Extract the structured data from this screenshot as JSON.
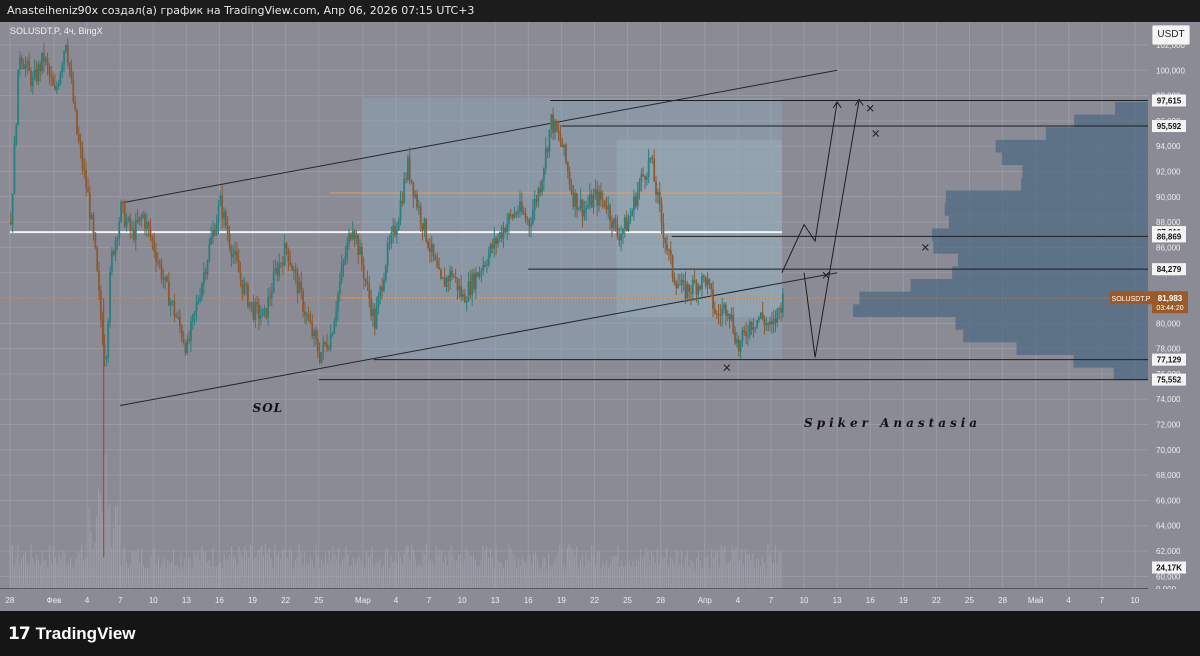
{
  "header": {
    "caption": "Anasteiheniz90x создал(а) график на TradingView.com, Апр 06, 2026 07:15 UTC+3"
  },
  "footer": {
    "logo_mark": "17",
    "logo_text": "TradingView"
  },
  "currency_button": "USDT",
  "colors": {
    "background": "#8b8b96",
    "up_candle": "#2a7f7f",
    "down_candle": "#8b5a32",
    "volume_profile": "#4f6a82",
    "value_area": "#8fa7b8",
    "level_line": "#1e1e1e",
    "orange_line": "#e0a060",
    "white_line": "#f2f2f2",
    "price_label_bg": "#9a5a2a"
  },
  "chart_data": {
    "type": "candlestick",
    "symbol_label": "SOLUSDT.P, 4ч, BingX",
    "ylim": [
      59000,
      103500
    ],
    "y_ticks": [
      "102,000",
      "100,000",
      "98,000",
      "96,000",
      "94,000",
      "92,000",
      "90,000",
      "88,000",
      "86,000",
      "84,000",
      "82,000",
      "80,000",
      "78,000",
      "76,000",
      "74,000",
      "72,000",
      "70,000",
      "68,000",
      "66,000",
      "64,000",
      "62,000",
      "60,000",
      "0,000"
    ],
    "y_tick_values": [
      102000,
      100000,
      98000,
      96000,
      94000,
      92000,
      90000,
      88000,
      86000,
      84000,
      82000,
      80000,
      78000,
      76000,
      74000,
      72000,
      70000,
      68000,
      66000,
      64000,
      62000,
      60000,
      59000
    ],
    "x_ticks": [
      {
        "label": "28",
        "day": -4
      },
      {
        "label": "Фев",
        "day": 0
      },
      {
        "label": "4",
        "day": 3
      },
      {
        "label": "7",
        "day": 6
      },
      {
        "label": "10",
        "day": 9
      },
      {
        "label": "13",
        "day": 12
      },
      {
        "label": "16",
        "day": 15
      },
      {
        "label": "19",
        "day": 18
      },
      {
        "label": "22",
        "day": 21
      },
      {
        "label": "25",
        "day": 24
      },
      {
        "label": "Мар",
        "day": 28
      },
      {
        "label": "4",
        "day": 31
      },
      {
        "label": "7",
        "day": 34
      },
      {
        "label": "10",
        "day": 37
      },
      {
        "label": "13",
        "day": 40
      },
      {
        "label": "16",
        "day": 43
      },
      {
        "label": "19",
        "day": 46
      },
      {
        "label": "22",
        "day": 49
      },
      {
        "label": "25",
        "day": 52
      },
      {
        "label": "28",
        "day": 55
      },
      {
        "label": "Апр",
        "day": 59
      },
      {
        "label": "4",
        "day": 62
      },
      {
        "label": "7",
        "day": 65
      },
      {
        "label": "10",
        "day": 68
      },
      {
        "label": "13",
        "day": 71
      },
      {
        "label": "16",
        "day": 74
      },
      {
        "label": "19",
        "day": 77
      },
      {
        "label": "22",
        "day": 80
      },
      {
        "label": "25",
        "day": 83
      },
      {
        "label": "28",
        "day": 86
      },
      {
        "label": "Май",
        "day": 89
      },
      {
        "label": "4",
        "day": 92
      },
      {
        "label": "7",
        "day": 95
      },
      {
        "label": "10",
        "day": 98
      }
    ],
    "price_path": [
      [
        -4,
        88000
      ],
      [
        -3.2,
        101500
      ],
      [
        -2,
        99000
      ],
      [
        -1,
        101000
      ],
      [
        0,
        98000
      ],
      [
        1,
        102500
      ],
      [
        2,
        95000
      ],
      [
        3,
        90000
      ],
      [
        3.6,
        86000
      ],
      [
        4.2,
        80000
      ],
      [
        4.6,
        77000
      ],
      [
        5.1,
        85000
      ],
      [
        6,
        89000
      ],
      [
        7,
        87000
      ],
      [
        8,
        88500
      ],
      [
        9,
        86000
      ],
      [
        10,
        83000
      ],
      [
        11,
        80500
      ],
      [
        12,
        78000
      ],
      [
        13,
        82000
      ],
      [
        14,
        86000
      ],
      [
        15,
        89500
      ],
      [
        16,
        86000
      ],
      [
        17,
        83000
      ],
      [
        18,
        81000
      ],
      [
        19,
        80500
      ],
      [
        20,
        84000
      ],
      [
        21,
        86000
      ],
      [
        22,
        83000
      ],
      [
        23,
        80000
      ],
      [
        24,
        77500
      ],
      [
        25,
        79000
      ],
      [
        26,
        84000
      ],
      [
        27,
        88000
      ],
      [
        28,
        84000
      ],
      [
        29,
        80000
      ],
      [
        30,
        85000
      ],
      [
        31,
        88000
      ],
      [
        32,
        92500
      ],
      [
        33,
        89000
      ],
      [
        34,
        86000
      ],
      [
        35,
        83000
      ],
      [
        36,
        84000
      ],
      [
        37,
        82000
      ],
      [
        38,
        83500
      ],
      [
        39,
        85000
      ],
      [
        40,
        86500
      ],
      [
        41,
        88000
      ],
      [
        42,
        89000
      ],
      [
        43,
        88000
      ],
      [
        44,
        91000
      ],
      [
        45,
        96000
      ],
      [
        46,
        94000
      ],
      [
        47,
        90000
      ],
      [
        48,
        89000
      ],
      [
        49,
        90000
      ],
      [
        50,
        89500
      ],
      [
        51,
        87000
      ],
      [
        52,
        88000
      ],
      [
        53,
        91000
      ],
      [
        54,
        93000
      ],
      [
        55,
        88000
      ],
      [
        56,
        84000
      ],
      [
        57,
        82500
      ],
      [
        58,
        83000
      ],
      [
        59,
        83500
      ],
      [
        60,
        80500
      ],
      [
        61,
        81500
      ],
      [
        62,
        78000
      ],
      [
        63,
        80000
      ],
      [
        64,
        80500
      ],
      [
        65,
        79500
      ],
      [
        66,
        81983
      ]
    ],
    "volume_profile_bins": [
      [
        97000,
        0.1
      ],
      [
        96000,
        0.22
      ],
      [
        95000,
        0.35
      ],
      [
        94000,
        0.5
      ],
      [
        93000,
        0.45
      ],
      [
        92000,
        0.38
      ],
      [
        91000,
        0.44
      ],
      [
        90000,
        0.55
      ],
      [
        89000,
        0.6
      ],
      [
        88000,
        0.62
      ],
      [
        87000,
        0.7
      ],
      [
        86000,
        0.6
      ],
      [
        85000,
        0.55
      ],
      [
        84000,
        0.68
      ],
      [
        83000,
        0.72
      ],
      [
        82000,
        0.95
      ],
      [
        81000,
        0.85
      ],
      [
        80000,
        0.65
      ],
      [
        79000,
        0.55
      ],
      [
        78000,
        0.4
      ],
      [
        77000,
        0.25
      ],
      [
        76000,
        0.12
      ]
    ],
    "price_labels": [
      {
        "value": 97615,
        "text": "97,615"
      },
      {
        "value": 95592,
        "text": "95,592"
      },
      {
        "value": 87211,
        "text": "87,211"
      },
      {
        "value": 86869,
        "text": "86,869"
      },
      {
        "value": 84279,
        "text": "84,279"
      },
      {
        "value": 77129,
        "text": "77,129"
      },
      {
        "value": 75552,
        "text": "75,552"
      },
      {
        "value": 60700,
        "text": "24,17K"
      }
    ],
    "current_price": {
      "ticker": "SOLUSDT.P",
      "value": 81983,
      "text": "81,983",
      "countdown": "03:44:20"
    },
    "horizontal_levels": [
      {
        "value": 97615,
        "from_day": 45,
        "kind": "black"
      },
      {
        "value": 95592,
        "from_day": 46,
        "kind": "black"
      },
      {
        "value": 86869,
        "from_day": 56,
        "kind": "black"
      },
      {
        "value": 84279,
        "from_day": 43,
        "kind": "black"
      },
      {
        "value": 77129,
        "from_day": 29,
        "kind": "black"
      },
      {
        "value": 75552,
        "from_day": 24,
        "kind": "black"
      },
      {
        "value": 90300,
        "from_day": 25,
        "to_day": 66,
        "kind": "orange"
      },
      {
        "value": 82000,
        "from_day": 25,
        "to_day": 66,
        "kind": "orange"
      },
      {
        "value": 87211,
        "from_day": -4,
        "to_day": 66,
        "kind": "white"
      }
    ],
    "channel": {
      "upper": [
        [
          6,
          89500
        ],
        [
          71,
          100000
        ]
      ],
      "lower": [
        [
          6,
          73500
        ],
        [
          71,
          84000
        ]
      ]
    },
    "forecast_paths": [
      [
        [
          66,
          84000
        ],
        [
          68,
          87800
        ],
        [
          69,
          86500
        ],
        [
          71,
          97500
        ]
      ],
      [
        [
          68,
          84000
        ],
        [
          69,
          77300
        ],
        [
          73,
          97700
        ]
      ]
    ],
    "cross_marks": [
      [
        74,
        97000
      ],
      [
        74.5,
        95000
      ],
      [
        79,
        86000
      ],
      [
        70,
        83800
      ],
      [
        61,
        76500
      ]
    ],
    "annotations": [
      {
        "text": "SOL",
        "day": 18,
        "value": 73000
      },
      {
        "text": "Spiker Anastasia",
        "day": 68,
        "value": 71800
      }
    ],
    "volume_bars_scale_max": 1.0
  }
}
